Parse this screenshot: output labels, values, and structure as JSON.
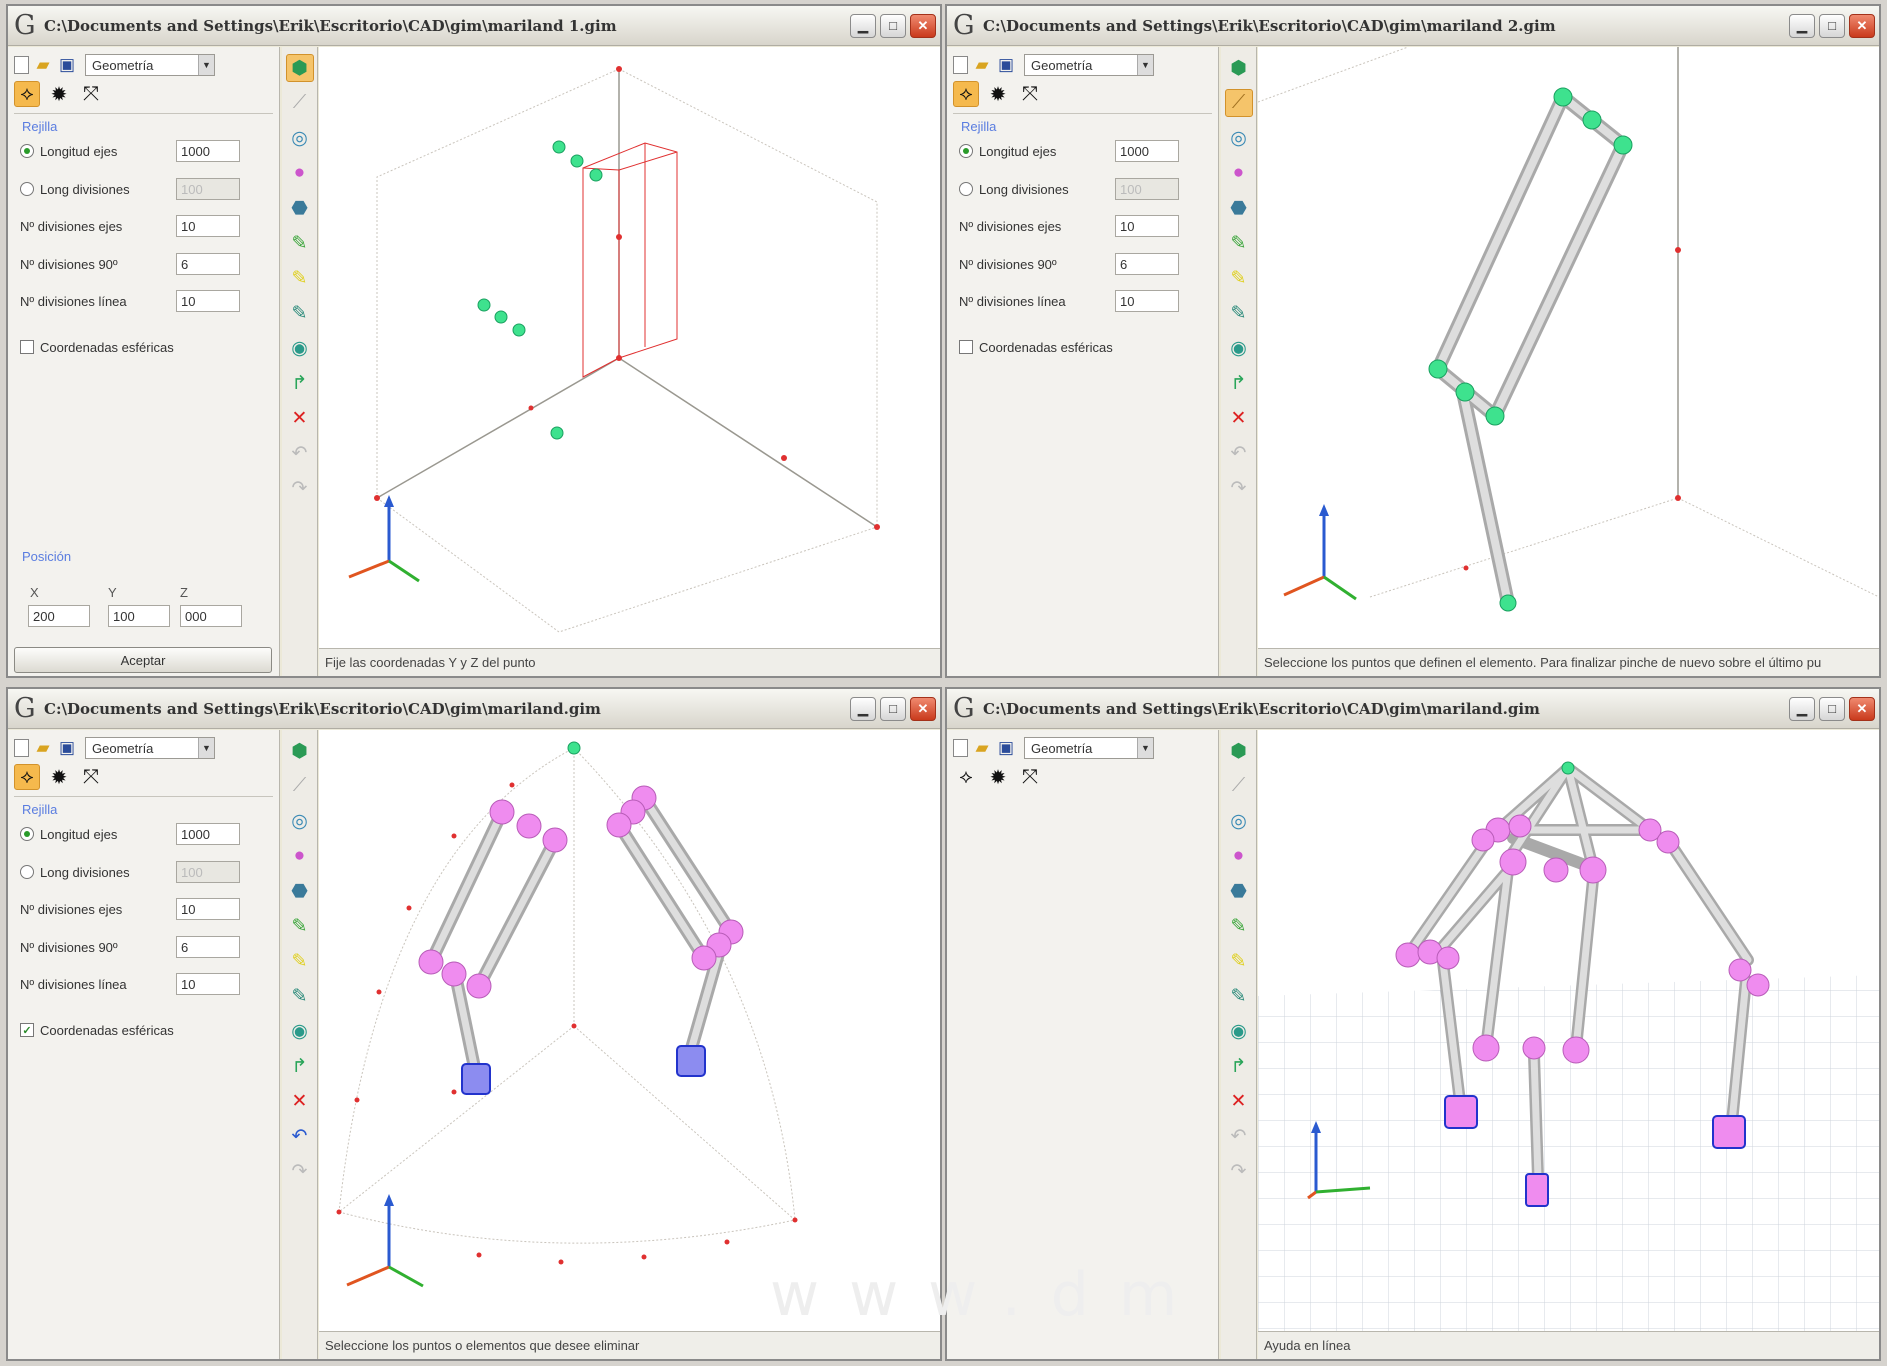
{
  "windows": [
    {
      "title": "C:\\Documents and Settings\\Erik\\Escritorio\\CAD\\gim\\mariland 1.gim",
      "combo": "Geometría",
      "section_grid": "Rejilla",
      "radio1_label": "Longitud ejes",
      "radio1_value": "1000",
      "radio2_label": "Long divisiones",
      "radio2_value": "100",
      "row3_label": "Nº divisiones ejes",
      "row3_value": "10",
      "row4_label": "Nº divisiones 90º",
      "row4_value": "6",
      "row5_label": "Nº divisiones línea",
      "row5_value": "10",
      "checkbox_label": "Coordenadas esféricas",
      "checkbox_checked": "",
      "section_position": "Posición",
      "x_label": "X",
      "y_label": "Y",
      "z_label": "Z",
      "x_value": "200",
      "y_value": "100",
      "z_value": "000",
      "accept_label": "Aceptar",
      "status": "Fije las coordenadas Y y Z del punto"
    },
    {
      "title": "C:\\Documents and Settings\\Erik\\Escritorio\\CAD\\gim\\mariland 2.gim",
      "combo": "Geometría",
      "section_grid": "Rejilla",
      "radio1_label": "Longitud ejes",
      "radio1_value": "1000",
      "radio2_label": "Long divisiones",
      "radio2_value": "100",
      "row3_label": "Nº divisiones ejes",
      "row3_value": "10",
      "row4_label": "Nº divisiones 90º",
      "row4_value": "6",
      "row5_label": "Nº divisiones línea",
      "row5_value": "10",
      "checkbox_label": "Coordenadas esféricas",
      "checkbox_checked": "",
      "status": "Seleccione los puntos que definen el elemento. Para finalizar pinche de nuevo sobre el último pu"
    },
    {
      "title": "C:\\Documents and Settings\\Erik\\Escritorio\\CAD\\gim\\mariland.gim",
      "combo": "Geometría",
      "section_grid": "Rejilla",
      "radio1_label": "Longitud ejes",
      "radio1_value": "1000",
      "radio2_label": "Long divisiones",
      "radio2_value": "100",
      "row3_label": "Nº divisiones ejes",
      "row3_value": "10",
      "row4_label": "Nº divisiones 90º",
      "row4_value": "6",
      "row5_label": "Nº divisiones línea",
      "row5_value": "10",
      "checkbox_label": "Coordenadas esféricas",
      "checkbox_checked": "✓",
      "status": "Seleccione los puntos o elementos que desee eliminar"
    },
    {
      "title": "C:\\Documents and Settings\\Erik\\Escritorio\\CAD\\gim\\mariland.gim",
      "combo": "Geometría",
      "status": "Ayuda en línea"
    }
  ],
  "watermark": "www.dm",
  "icons": {
    "minimize": "minimize-icon",
    "maximize": "maximize-icon",
    "close": "close-icon"
  },
  "colors": {
    "node_green": "#22dd88",
    "node_pink": "#ee88ee",
    "support_blue": "#3344dd",
    "axis_red": "#dd3333",
    "bar_grey": "#cccccc",
    "accent_orange": "#f5b94d"
  }
}
